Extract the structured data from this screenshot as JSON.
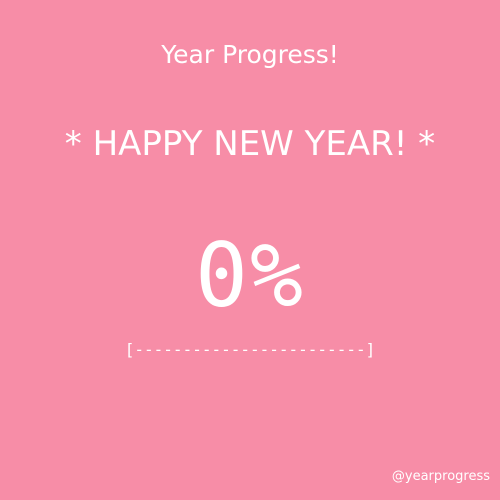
{
  "title": "Year Progress!",
  "headline": "* HAPPY NEW YEAR! *",
  "progress": {
    "percent_label": "0%",
    "value": 0,
    "bar_text": "[------------------------]"
  },
  "handle": "@yearprogress",
  "colors": {
    "background": "#F78DA7",
    "text": "#FFFFFF"
  }
}
